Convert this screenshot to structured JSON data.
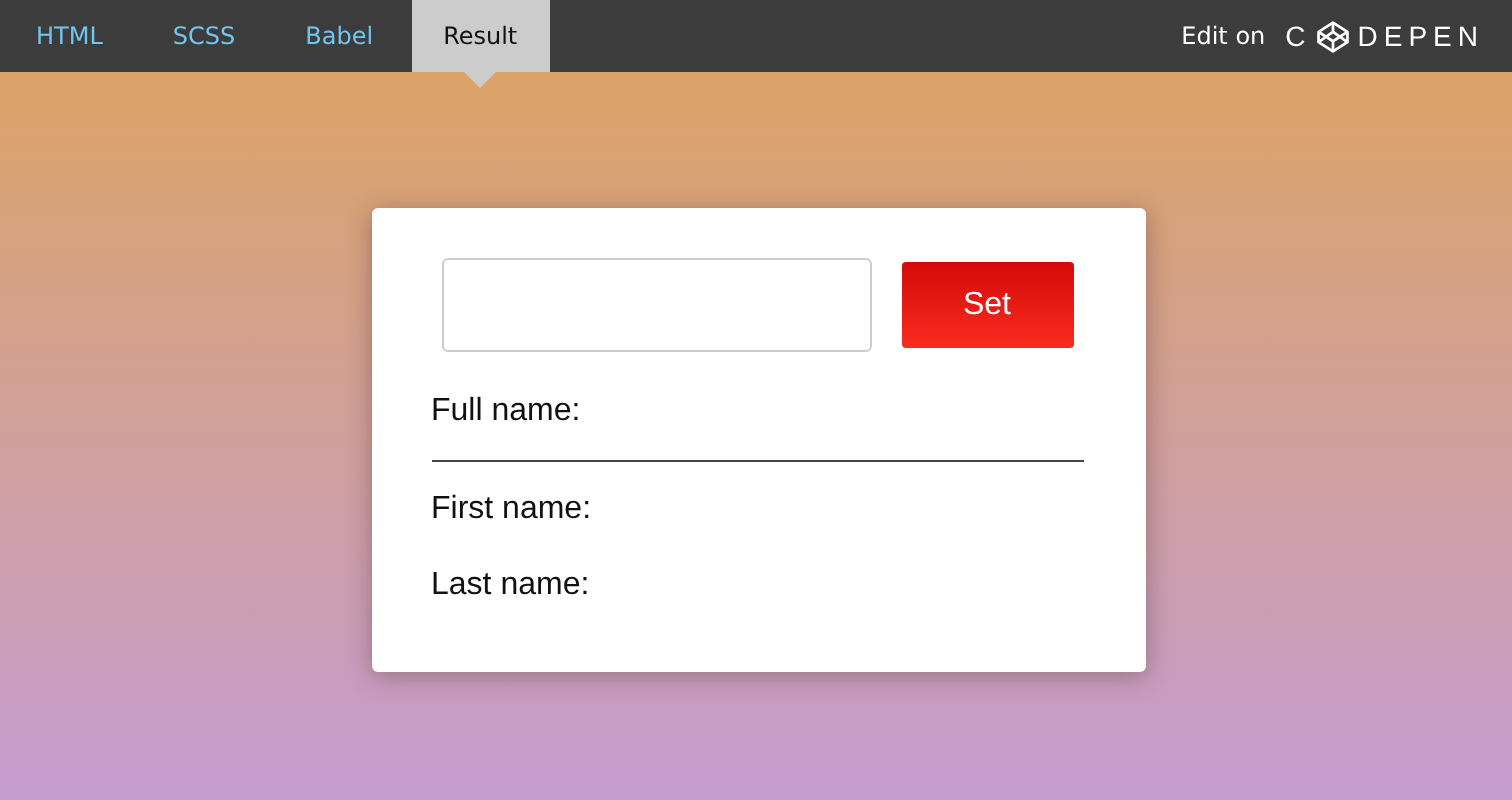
{
  "tabs": [
    {
      "label": "HTML",
      "selected": false
    },
    {
      "label": "SCSS",
      "selected": false
    },
    {
      "label": "Babel",
      "selected": false
    },
    {
      "label": "Result",
      "selected": true
    }
  ],
  "edit_on": "Edit on",
  "logo": {
    "before_icon": "C",
    "after_icon": "DEPEN"
  },
  "form": {
    "button": "Set",
    "full_name": "Full name:",
    "first_name": "First name:",
    "last_name": "Last name:"
  }
}
